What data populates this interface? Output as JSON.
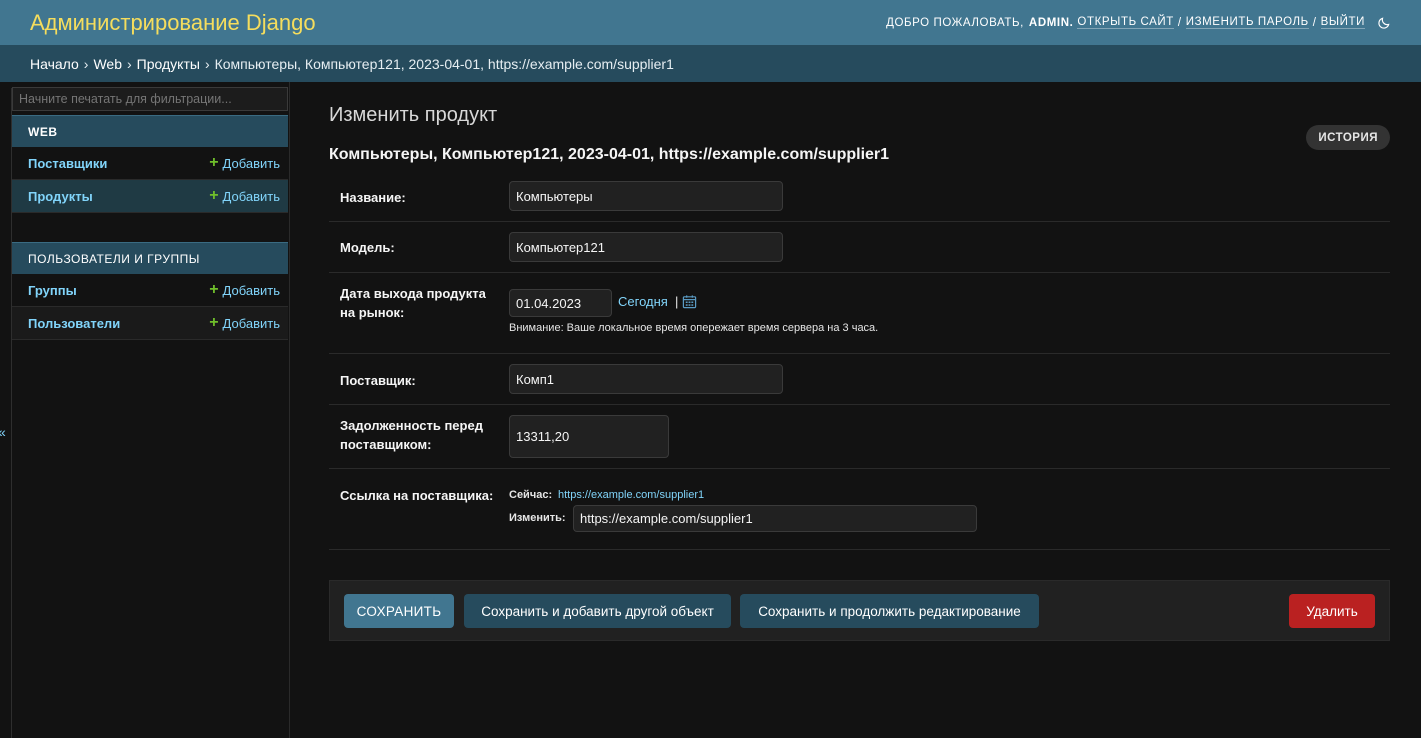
{
  "header": {
    "brand": "Администрирование Django",
    "welcome": "ДОБРО ПОЖАЛОВАТЬ,",
    "username": "ADMIN.",
    "view_site": "ОТКРЫТЬ САЙТ",
    "change_password": "ИЗМЕНИТЬ ПАРОЛЬ",
    "logout": "ВЫЙТИ",
    "sep": "/",
    "theme_icon": "moon-icon"
  },
  "breadcrumbs": {
    "home": "Начало",
    "app": "Web",
    "model": "Продукты",
    "object": "Компьютеры, Компьютер121, 2023-04-01, https://example.com/supplier1",
    "arrow": "›"
  },
  "sidebar": {
    "filter_placeholder": "Начните печатать для фильтрации...",
    "add_label": "Добавить",
    "modules": [
      {
        "title": "WEB",
        "items": [
          {
            "label": "Поставщики",
            "active": false
          },
          {
            "label": "Продукты",
            "active": true
          }
        ]
      },
      {
        "title": "ПОЛЬЗОВАТЕЛИ И ГРУППЫ",
        "items": [
          {
            "label": "Группы",
            "active": false
          },
          {
            "label": "Пользователи",
            "active": false
          }
        ]
      }
    ],
    "collapse_glyph": "«"
  },
  "main": {
    "page_title": "Изменить продукт",
    "history_label": "ИСТОРИЯ",
    "object_title": "Компьютеры, Компьютер121, 2023-04-01, https://example.com/supplier1",
    "fields": {
      "name": {
        "label": "Название:",
        "value": "Компьютеры"
      },
      "model": {
        "label": "Модель:",
        "value": "Компьютер121"
      },
      "release_date": {
        "label_line1": "Дата выхода продукта",
        "label_line2": "на рынок:",
        "value": "01.04.2023",
        "today": "Сегодня",
        "pipe": "|",
        "calendar_icon": "calendar-icon",
        "help": "Внимание: Ваше локальное время опережает время сервера на 3 часа."
      },
      "supplier": {
        "label": "Поставщик:",
        "value": "Комп1"
      },
      "debt": {
        "label_line1": "Задолженность перед",
        "label_line2": "поставщиком:",
        "value": "13311,20"
      },
      "supplier_link": {
        "label": "Ссылка на поставщика:",
        "current_label": "Сейчас:",
        "current_value": "https://example.com/supplier1",
        "change_label": "Изменить:",
        "change_value": "https://example.com/supplier1"
      }
    }
  },
  "actions": {
    "save": "СОХРАНИТЬ",
    "save_add": "Сохранить и добавить другой объект",
    "save_continue": "Сохранить и продолжить редактирование",
    "delete": "Удалить"
  }
}
